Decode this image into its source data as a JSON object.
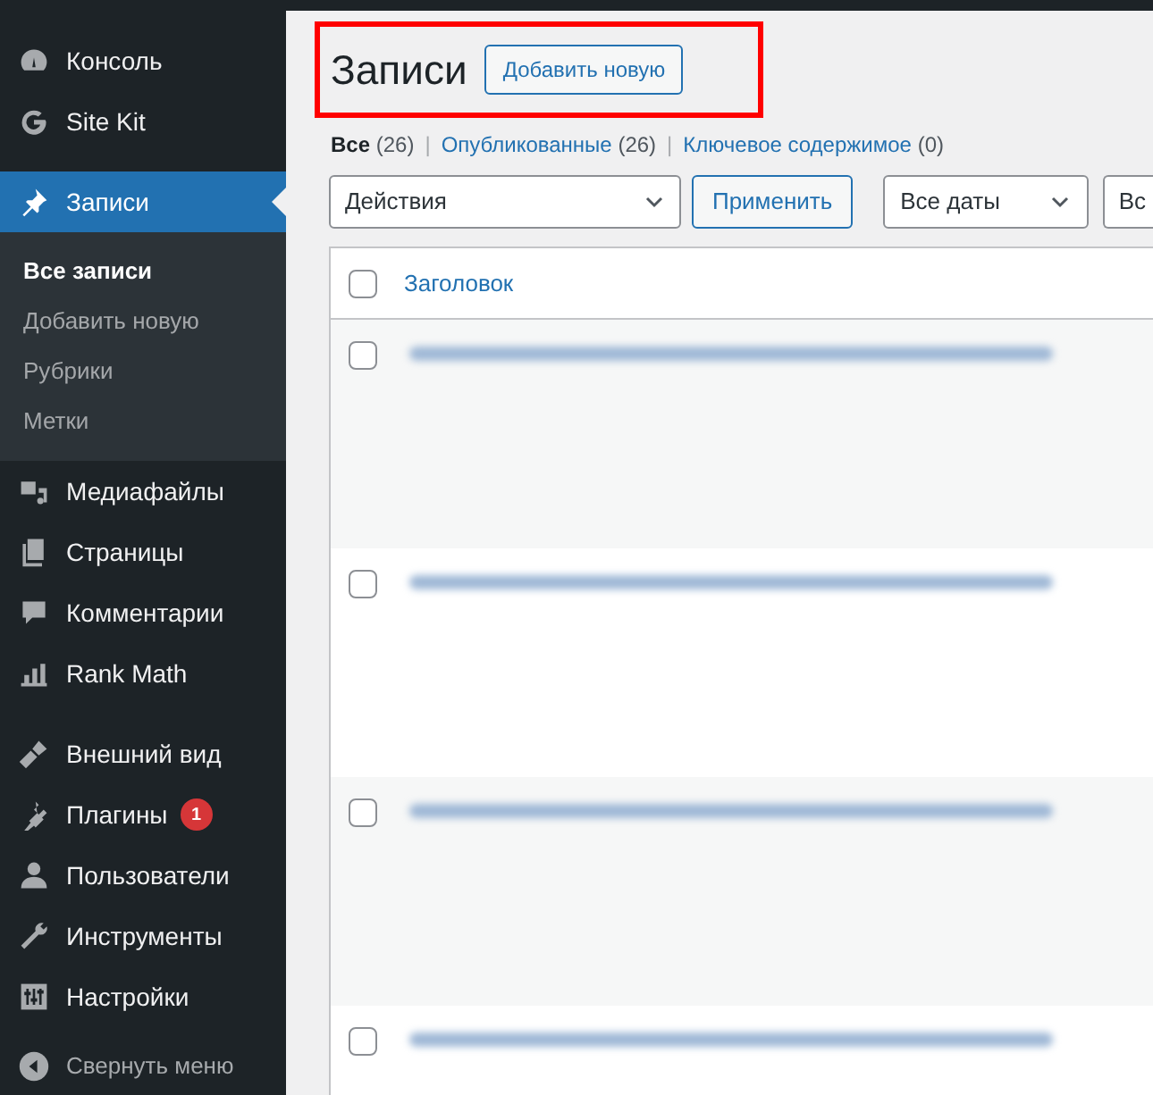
{
  "sidebar": {
    "groups": [
      {
        "items": [
          {
            "label": "Консоль",
            "selected": false
          },
          {
            "label": "Site Kit",
            "selected": false
          }
        ]
      },
      {
        "items": [
          {
            "label": "Записи",
            "selected": true,
            "children": [
              {
                "label": "Все записи",
                "selected": true
              },
              {
                "label": "Добавить новую",
                "selected": false
              },
              {
                "label": "Рубрики",
                "selected": false
              },
              {
                "label": "Метки",
                "selected": false
              }
            ]
          },
          {
            "label": "Медиафайлы",
            "selected": false
          },
          {
            "label": "Страницы",
            "selected": false
          },
          {
            "label": "Комментарии",
            "selected": false
          },
          {
            "label": "Rank Math",
            "selected": false
          }
        ]
      },
      {
        "items": [
          {
            "label": "Внешний вид",
            "selected": false
          },
          {
            "label": "Плагины",
            "selected": false,
            "badge": "1"
          },
          {
            "label": "Пользователи",
            "selected": false
          },
          {
            "label": "Инструменты",
            "selected": false
          },
          {
            "label": "Настройки",
            "selected": false
          }
        ]
      }
    ],
    "collapse": "Свернуть меню"
  },
  "page": {
    "title": "Записи",
    "add_button": "Добавить новую",
    "highlighted": true,
    "filters": [
      {
        "label": "Все",
        "count": "(26)",
        "selected": true
      },
      {
        "separator": "|",
        "label": "Опубликованные",
        "count": "(26)",
        "selected": false
      },
      {
        "separator": "|",
        "label": "Ключевое содержимое",
        "count": "(0)",
        "selected": false
      }
    ],
    "bulk_action": "Действия",
    "apply": "Применить",
    "date_filter": "Все даты",
    "filter_3": "Вс",
    "table": {
      "select_all_checked": false,
      "columns": [
        "Заголовок"
      ],
      "rows": [
        {
          "checked": false
        },
        {
          "checked": false
        },
        {
          "checked": false
        },
        {
          "checked": false
        }
      ]
    }
  }
}
